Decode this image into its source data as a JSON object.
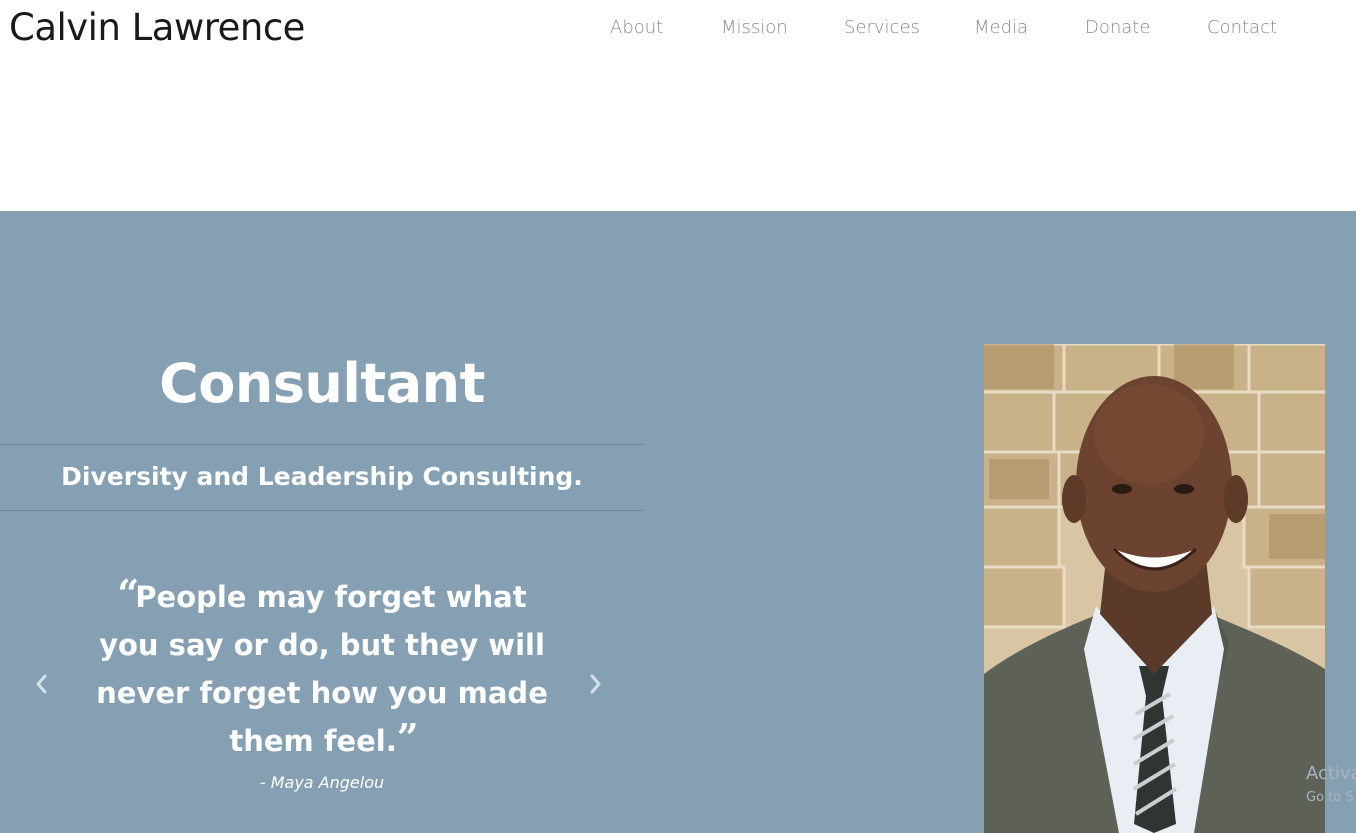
{
  "site": {
    "logo": "Calvin Lawrence"
  },
  "nav": {
    "items": [
      {
        "label": "About"
      },
      {
        "label": "Mission"
      },
      {
        "label": "Services"
      },
      {
        "label": "Media"
      },
      {
        "label": "Donate"
      },
      {
        "label": "Contact"
      }
    ]
  },
  "hero": {
    "title": "Consultant",
    "subtitle": "Diversity and Leadership Consulting.",
    "quote": {
      "open_mark": "“",
      "text": "People may forget what you say or do, but they will never forget how you made them feel.",
      "close_mark": "”",
      "author": "- Maya Angelou"
    },
    "carousel": {
      "prev_icon": "chevron-left-icon",
      "next_icon": "chevron-right-icon"
    },
    "photo": {
      "subject": "portrait-photo"
    }
  },
  "overlay": {
    "watermark_line1": "Activa",
    "watermark_line2": "Go to S"
  },
  "colors": {
    "hero_bg": "#86a0b3",
    "logo_text": "#1a1a1a",
    "nav_text": "#8a8a8a",
    "hero_text": "#ffffff"
  }
}
